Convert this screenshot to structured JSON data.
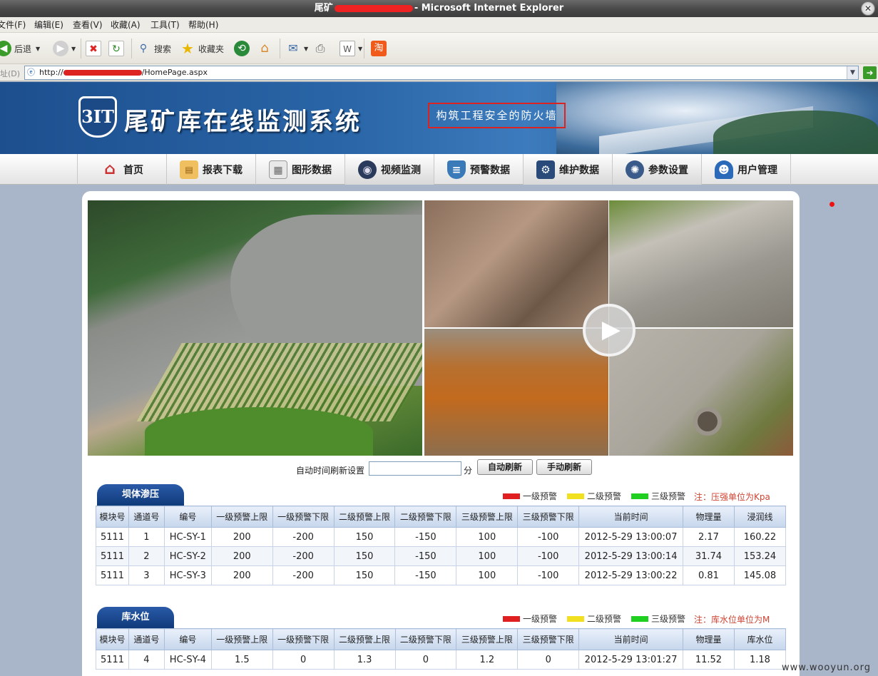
{
  "window": {
    "title_prefix": "尾矿",
    "title_suffix": "- Microsoft Internet Explorer"
  },
  "menu": [
    "文件(F)",
    "编辑(E)",
    "查看(V)",
    "收藏(A)",
    "工具(T)",
    "帮助(H)"
  ],
  "toolbar": {
    "back_label": "后退",
    "search_label": "搜索",
    "favorites_label": "收藏夹"
  },
  "address": {
    "label": "址(D)",
    "url_prefix": "http://",
    "url_suffix": "/HomePage.aspx"
  },
  "banner": {
    "logo_text": "3IT",
    "system_title": "尾矿库在线监测系统",
    "slogan": "构筑工程安全的防火墙"
  },
  "nav": [
    {
      "label": "首页",
      "icon": "home-icon"
    },
    {
      "label": "报表下载",
      "icon": "calendar-icon"
    },
    {
      "label": "图形数据",
      "icon": "grid-icon"
    },
    {
      "label": "视频监测",
      "icon": "camera-icon"
    },
    {
      "label": "预警数据",
      "icon": "shield-icon"
    },
    {
      "label": "维护数据",
      "icon": "gear-icon"
    },
    {
      "label": "参数设置",
      "icon": "settings-icon"
    },
    {
      "label": "用户管理",
      "icon": "user-icon"
    }
  ],
  "refresh": {
    "label": "自动时间刷新设置",
    "value": "",
    "unit": "分",
    "auto_button": "自动刷新",
    "manual_button": "手动刷新"
  },
  "legend": {
    "level1": "一级预警",
    "level2": "二级预警",
    "level3": "三级预警",
    "colors": {
      "level1": "#e02020",
      "level2": "#f0e020",
      "level3": "#20d020"
    }
  },
  "seepage": {
    "tab": "坝体渗压",
    "note": "注：压强单位为Kpa",
    "columns": [
      "模块号",
      "通道号",
      "编号",
      "一级预警上限",
      "一级预警下限",
      "二级预警上限",
      "二级预警下限",
      "三级预警上限",
      "三级预警下限",
      "当前时间",
      "物理量",
      "浸润线"
    ],
    "rows": [
      [
        "5111",
        "1",
        "HC-SY-1",
        "200",
        "-200",
        "150",
        "-150",
        "100",
        "-100",
        "2012-5-29 13:00:07",
        "2.17",
        "160.22"
      ],
      [
        "5111",
        "2",
        "HC-SY-2",
        "200",
        "-200",
        "150",
        "-150",
        "100",
        "-100",
        "2012-5-29 13:00:14",
        "31.74",
        "153.24"
      ],
      [
        "5111",
        "3",
        "HC-SY-3",
        "200",
        "-200",
        "150",
        "-150",
        "100",
        "-100",
        "2012-5-29 13:00:22",
        "0.81",
        "145.08"
      ]
    ]
  },
  "water_level": {
    "tab": "库水位",
    "note": "注：库水位单位为M",
    "columns": [
      "模块号",
      "通道号",
      "编号",
      "一级预警上限",
      "一级预警下限",
      "二级预警上限",
      "二级预警下限",
      "三级预警上限",
      "三级预警下限",
      "当前时间",
      "物理量",
      "库水位"
    ],
    "rows": [
      [
        "5111",
        "4",
        "HC-SY-4",
        "1.5",
        "0",
        "1.3",
        "0",
        "1.2",
        "0",
        "2012-5-29 13:01:27",
        "11.52",
        "1.18"
      ]
    ]
  },
  "watermark": "www.wooyun.org"
}
